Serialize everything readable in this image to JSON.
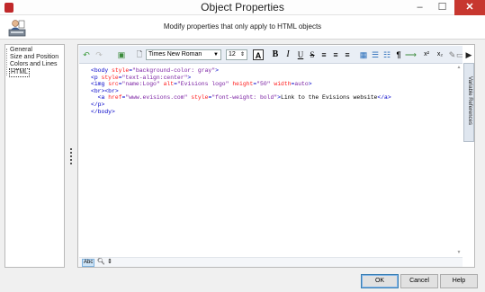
{
  "window": {
    "title": "Object Properties",
    "min_glyph": "–",
    "max_glyph": "☐",
    "close_glyph": "✕"
  },
  "header": {
    "text": "Modify properties that only apply to HTML objects"
  },
  "tree": {
    "items": [
      {
        "label": "General"
      },
      {
        "label": "Size and Position"
      },
      {
        "label": "Colors and Lines"
      },
      {
        "label": "HTML",
        "selected": true
      }
    ]
  },
  "toolbar": {
    "font_name": "Times New Roman",
    "font_size": "12",
    "bold": "B",
    "italic": "I",
    "underline": "U",
    "strike": "S",
    "paragraph": "¶",
    "superscript": "x²",
    "subscript": "x₂"
  },
  "code_lines": [
    [
      {
        "t": "tag",
        "v": "<body "
      },
      {
        "t": "attr",
        "v": "style"
      },
      {
        "t": "tag",
        "v": "="
      },
      {
        "t": "val",
        "v": "\"background-color: gray\""
      },
      {
        "t": "tag",
        "v": ">"
      }
    ],
    [
      {
        "t": "tag",
        "v": "<p "
      },
      {
        "t": "attr",
        "v": "style"
      },
      {
        "t": "tag",
        "v": "="
      },
      {
        "t": "val",
        "v": "\"text-align:center\""
      },
      {
        "t": "tag",
        "v": ">"
      }
    ],
    [
      {
        "t": "tag",
        "v": "<img "
      },
      {
        "t": "attr",
        "v": "src"
      },
      {
        "t": "tag",
        "v": "="
      },
      {
        "t": "val",
        "v": "\"name:Logo\""
      },
      {
        "t": "tag",
        "v": " "
      },
      {
        "t": "attr",
        "v": "alt"
      },
      {
        "t": "tag",
        "v": "="
      },
      {
        "t": "val",
        "v": "\"Evisions logo\""
      },
      {
        "t": "tag",
        "v": " "
      },
      {
        "t": "attr",
        "v": "height"
      },
      {
        "t": "tag",
        "v": "="
      },
      {
        "t": "val",
        "v": "\"50\""
      },
      {
        "t": "tag",
        "v": " "
      },
      {
        "t": "attr",
        "v": "width"
      },
      {
        "t": "tag",
        "v": "="
      },
      {
        "t": "val",
        "v": "auto"
      },
      {
        "t": "tag",
        "v": ">"
      }
    ],
    [
      {
        "t": "tag",
        "v": "<br><br>"
      }
    ],
    [
      {
        "t": "txt",
        "v": "  "
      },
      {
        "t": "tag",
        "v": "<a "
      },
      {
        "t": "attr",
        "v": "href"
      },
      {
        "t": "tag",
        "v": "="
      },
      {
        "t": "val",
        "v": "\"www.evisions.com\""
      },
      {
        "t": "tag",
        "v": " "
      },
      {
        "t": "attr",
        "v": "style"
      },
      {
        "t": "tag",
        "v": "="
      },
      {
        "t": "val",
        "v": "\"font-weight: bold\""
      },
      {
        "t": "tag",
        "v": ">"
      },
      {
        "t": "txt",
        "v": "Link to the Evisions website"
      },
      {
        "t": "tag",
        "v": "</a>"
      }
    ],
    [
      {
        "t": "tag",
        "v": "</p>"
      }
    ],
    [
      {
        "t": "tag",
        "v": "</body>"
      }
    ]
  ],
  "side_tab": {
    "label": "Variable References"
  },
  "status": {
    "spell_label": "Abc"
  },
  "buttons": {
    "ok": "OK",
    "cancel": "Cancel",
    "help": "Help"
  },
  "colors": {
    "tag": "#0000c8",
    "attribute": "#ff1a1a",
    "value": "#7a1fa2",
    "close_button": "#c7372f"
  }
}
